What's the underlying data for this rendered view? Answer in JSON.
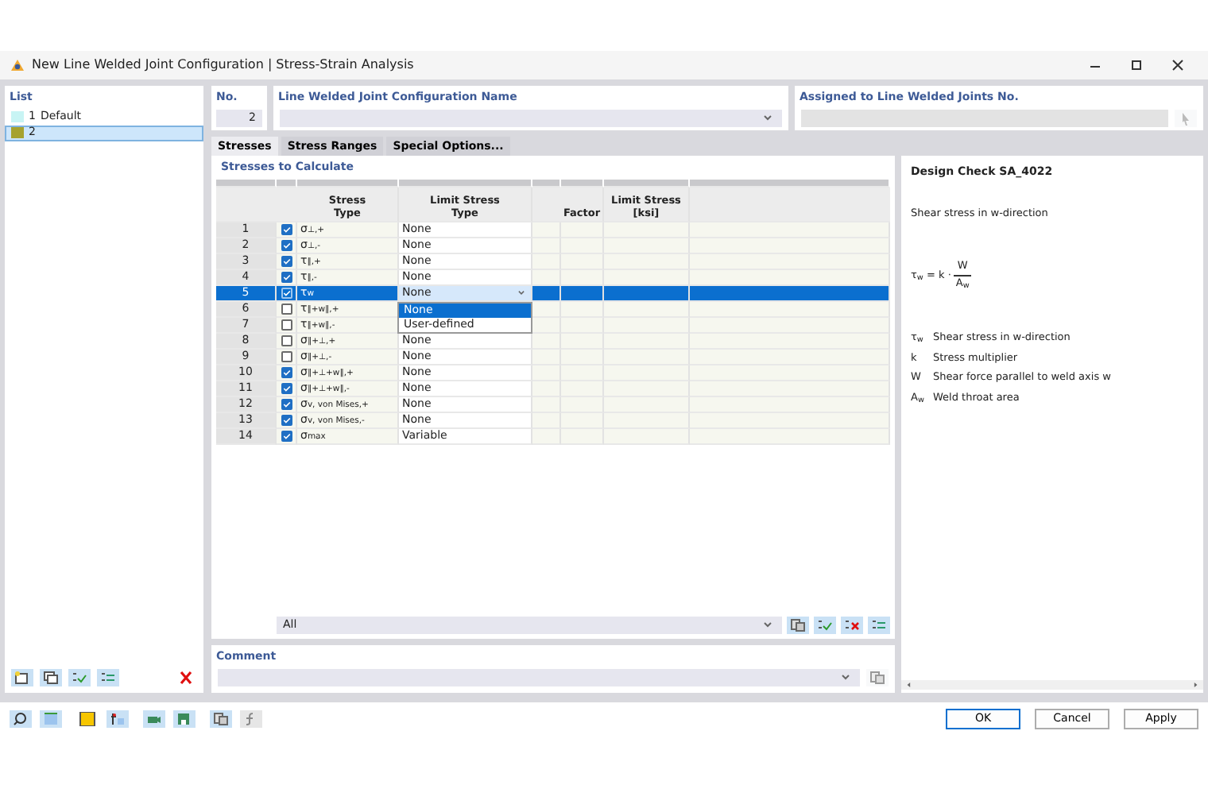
{
  "window": {
    "title": "New Line Welded Joint Configuration | Stress-Strain Analysis"
  },
  "list": {
    "title": "List",
    "items": [
      {
        "number": "1",
        "label": "Default",
        "color": "#c8f4f4",
        "selected": false
      },
      {
        "number": "2",
        "color": "#a6a22e",
        "selected": true
      }
    ]
  },
  "number": {
    "label": "No.",
    "value": "2"
  },
  "name": {
    "label": "Line Welded Joint Configuration Name"
  },
  "assigned": {
    "label": "Assigned to Line Welded Joints No."
  },
  "tabs": [
    {
      "label": "Stresses",
      "selected": true
    },
    {
      "label": "Stress Ranges",
      "selected": false
    },
    {
      "label": "Special Options...",
      "selected": false
    }
  ],
  "stresses": {
    "title": "Stresses to Calculate",
    "columns": [
      "Stress\nType",
      "Limit Stress\nType",
      "Factor",
      "Limit Stress\n[ksi]"
    ],
    "rows": [
      {
        "number": "1",
        "checked": true,
        "stress_type": "σ$_{⊥,+}$",
        "limit_type": "None",
        "selected": false
      },
      {
        "number": "2",
        "checked": true,
        "stress_type": "σ$_{⊥,-}$",
        "limit_type": "None",
        "selected": false
      },
      {
        "number": "3",
        "checked": true,
        "stress_type": "τ$_{∥,+}$",
        "limit_type": "None",
        "selected": false
      },
      {
        "number": "4",
        "checked": true,
        "stress_type": "τ$_{∥,-}$",
        "limit_type": "None",
        "selected": false
      },
      {
        "number": "5",
        "checked": true,
        "stress_type": "τ$_{w}$",
        "limit_type": "None",
        "selected": true,
        "dropdown_open": true
      },
      {
        "number": "6",
        "checked": false,
        "stress_type": "τ$_{∥+w∥,+}$",
        "selected": false
      },
      {
        "number": "7",
        "checked": false,
        "stress_type": "τ$_{∥+w∥,-}$",
        "selected": false
      },
      {
        "number": "8",
        "checked": false,
        "stress_type": "σ$_{∥+⊥,+}$",
        "limit_type": "None",
        "selected": false
      },
      {
        "number": "9",
        "checked": false,
        "stress_type": "σ$_{∥+⊥,-}$",
        "limit_type": "None",
        "selected": false
      },
      {
        "number": "10",
        "checked": true,
        "stress_type": "σ$_{∥+⊥+w∥,+}$",
        "limit_type": "None",
        "selected": false
      },
      {
        "number": "11",
        "checked": true,
        "stress_type": "σ$_{∥+⊥+w∥,-}$",
        "limit_type": "None",
        "selected": false
      },
      {
        "number": "12",
        "checked": true,
        "stress_type": "σ$_{v, von Mises,+}$",
        "limit_type": "None",
        "selected": false
      },
      {
        "number": "13",
        "checked": true,
        "stress_type": "σ$_{v, von Mises,-}$",
        "limit_type": "None",
        "selected": false
      },
      {
        "number": "14",
        "checked": true,
        "stress_type": "σ$_{max}$",
        "limit_type": "Variable",
        "selected": false
      }
    ],
    "dropdown": [
      {
        "label": "None",
        "selected": true
      },
      {
        "label": "User-defined",
        "selected": false
      }
    ],
    "filter": {
      "value": "All"
    }
  },
  "comment": {
    "label": "Comment"
  },
  "design_check": {
    "title": "Design Check SA_4022",
    "description": "Shear stress in w-direction",
    "formula": {
      "lhs": "τ$_{w}$ = k ·",
      "numerator": "W",
      "denominator": "A$_{w}$"
    },
    "legend": [
      {
        "symbol": "τ$_{w}$",
        "text": "Shear stress in w-direction"
      },
      {
        "symbol": "k",
        "text": "Stress multiplier"
      },
      {
        "symbol": "W",
        "text": "Shear force parallel to weld axis w"
      },
      {
        "symbol": "A$_{w}$",
        "text": "Weld throat area"
      }
    ]
  },
  "buttons": [
    "OK",
    "Cancel",
    "Apply"
  ]
}
